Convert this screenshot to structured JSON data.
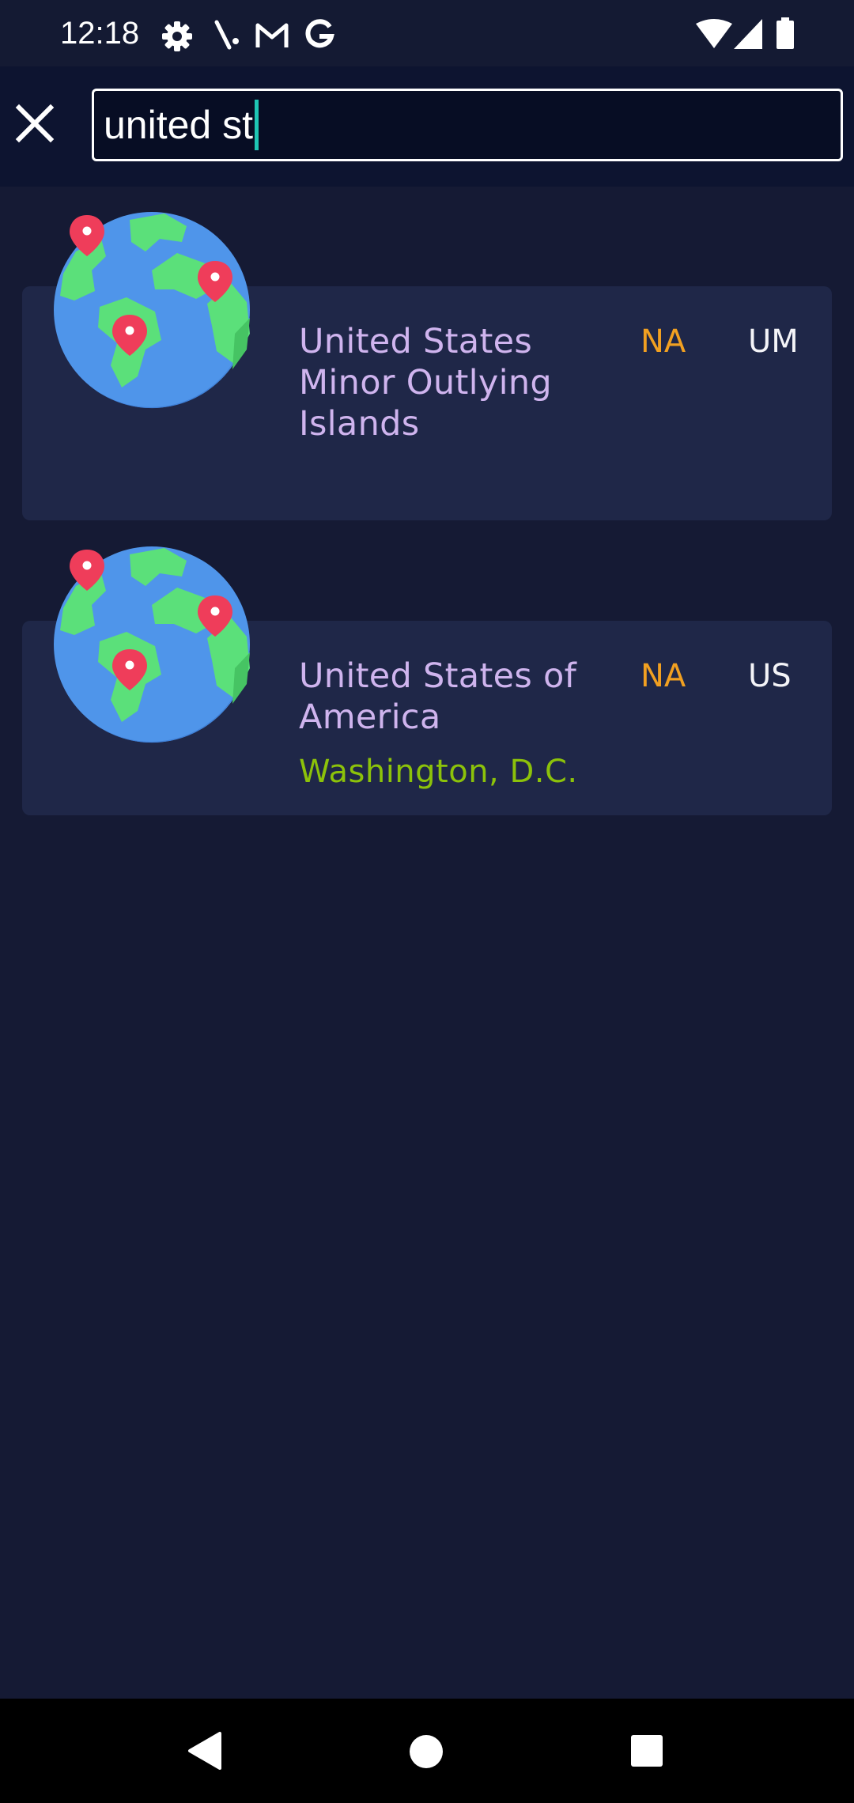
{
  "status_bar": {
    "time": "12:18",
    "left_icons": [
      "gear-icon",
      "signal-slash-icon",
      "gmail-icon",
      "google-icon"
    ],
    "right_icons": [
      "wifi-icon",
      "cell-signal-icon",
      "battery-icon"
    ]
  },
  "search": {
    "value": "united st",
    "close_icon": "close-icon",
    "accent_color": "#1ec6b5"
  },
  "results": [
    {
      "name": "United States Minor Outlying Islands",
      "region": "NA",
      "code": "UM",
      "capital": "",
      "icon": "globe-icon"
    },
    {
      "name": "United States of America",
      "region": "NA",
      "code": "US",
      "capital": "Washington, D.C.",
      "icon": "globe-icon"
    }
  ],
  "colors": {
    "background": "#151a34",
    "card": "#1f2748",
    "name": "#cfb4ee",
    "region": "#f1a021",
    "capital": "#8cc20a"
  },
  "nav_bar": {
    "buttons": [
      "back-icon",
      "home-icon",
      "recents-icon"
    ]
  }
}
